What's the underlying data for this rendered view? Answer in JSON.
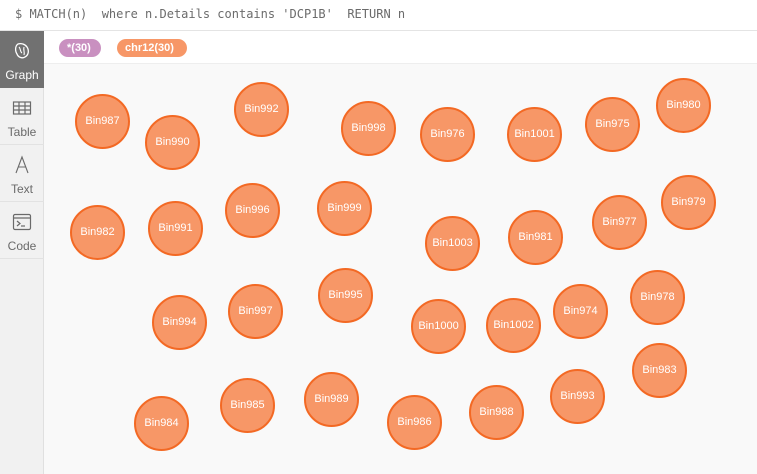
{
  "query": {
    "text": "$ MATCH(n)  where n.Details contains 'DCP1B'  RETURN n"
  },
  "sidebar": {
    "tabs": [
      {
        "label": "Graph",
        "icon": "graph-icon",
        "active": true
      },
      {
        "label": "Table",
        "icon": "table-icon",
        "active": false
      },
      {
        "label": "Text",
        "icon": "text-icon",
        "active": false
      },
      {
        "label": "Code",
        "icon": "code-icon",
        "active": false
      }
    ]
  },
  "stats": {
    "all_label": "*(30)",
    "all_color": "#c990c0",
    "chr12_label": "chr12(30)",
    "chr12_color": "#f79767"
  },
  "colors": {
    "node_fill": "#f79767",
    "node_border": "#f36924"
  },
  "nodes": [
    "Bin987",
    "Bin990",
    "Bin992",
    "Bin998",
    "Bin976",
    "Bin1001",
    "Bin975",
    "Bin980",
    "Bin982",
    "Bin991",
    "Bin996",
    "Bin999",
    "Bin1003",
    "Bin981",
    "Bin977",
    "Bin979",
    "Bin994",
    "Bin997",
    "Bin995",
    "Bin1000",
    "Bin1002",
    "Bin974",
    "Bin978",
    "Bin983",
    "Bin984",
    "Bin985",
    "Bin989",
    "Bin986",
    "Bin988",
    "Bin993"
  ]
}
